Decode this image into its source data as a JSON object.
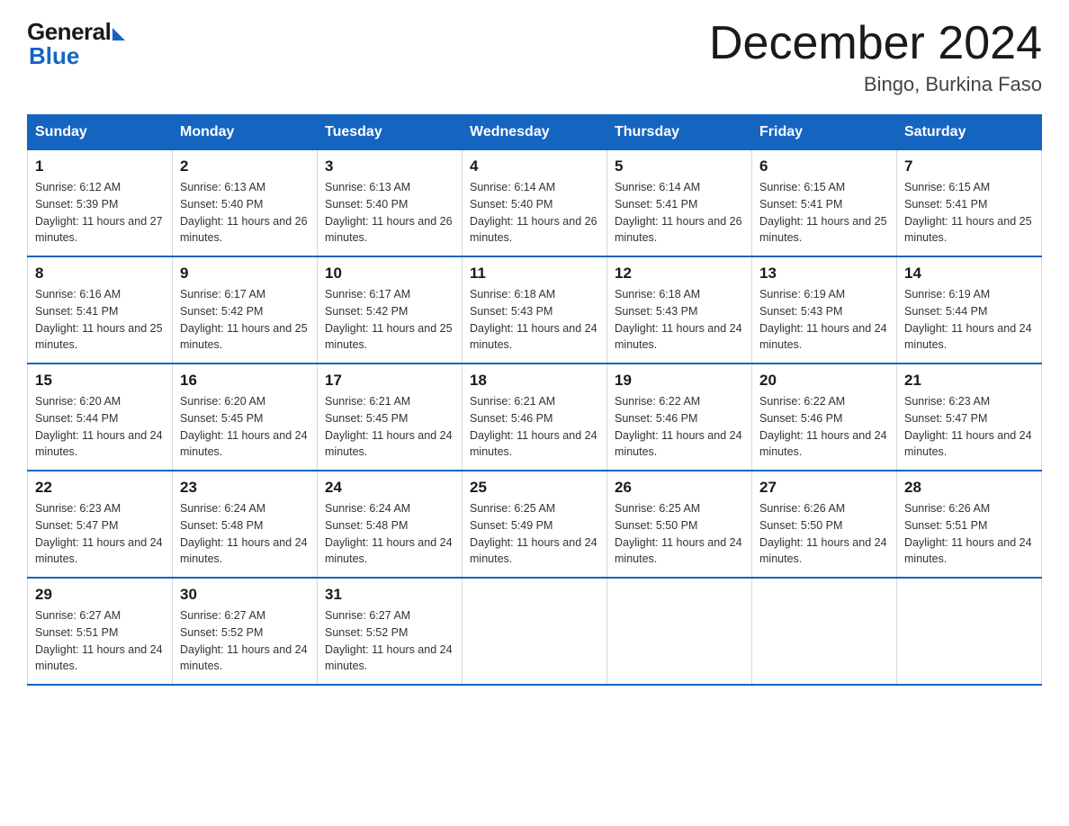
{
  "logo": {
    "general": "General",
    "blue": "Blue"
  },
  "header": {
    "title": "December 2024",
    "subtitle": "Bingo, Burkina Faso"
  },
  "days_of_week": [
    "Sunday",
    "Monday",
    "Tuesday",
    "Wednesday",
    "Thursday",
    "Friday",
    "Saturday"
  ],
  "weeks": [
    [
      {
        "day": "1",
        "sunrise": "6:12 AM",
        "sunset": "5:39 PM",
        "daylight": "11 hours and 27 minutes."
      },
      {
        "day": "2",
        "sunrise": "6:13 AM",
        "sunset": "5:40 PM",
        "daylight": "11 hours and 26 minutes."
      },
      {
        "day": "3",
        "sunrise": "6:13 AM",
        "sunset": "5:40 PM",
        "daylight": "11 hours and 26 minutes."
      },
      {
        "day": "4",
        "sunrise": "6:14 AM",
        "sunset": "5:40 PM",
        "daylight": "11 hours and 26 minutes."
      },
      {
        "day": "5",
        "sunrise": "6:14 AM",
        "sunset": "5:41 PM",
        "daylight": "11 hours and 26 minutes."
      },
      {
        "day": "6",
        "sunrise": "6:15 AM",
        "sunset": "5:41 PM",
        "daylight": "11 hours and 25 minutes."
      },
      {
        "day": "7",
        "sunrise": "6:15 AM",
        "sunset": "5:41 PM",
        "daylight": "11 hours and 25 minutes."
      }
    ],
    [
      {
        "day": "8",
        "sunrise": "6:16 AM",
        "sunset": "5:41 PM",
        "daylight": "11 hours and 25 minutes."
      },
      {
        "day": "9",
        "sunrise": "6:17 AM",
        "sunset": "5:42 PM",
        "daylight": "11 hours and 25 minutes."
      },
      {
        "day": "10",
        "sunrise": "6:17 AM",
        "sunset": "5:42 PM",
        "daylight": "11 hours and 25 minutes."
      },
      {
        "day": "11",
        "sunrise": "6:18 AM",
        "sunset": "5:43 PM",
        "daylight": "11 hours and 24 minutes."
      },
      {
        "day": "12",
        "sunrise": "6:18 AM",
        "sunset": "5:43 PM",
        "daylight": "11 hours and 24 minutes."
      },
      {
        "day": "13",
        "sunrise": "6:19 AM",
        "sunset": "5:43 PM",
        "daylight": "11 hours and 24 minutes."
      },
      {
        "day": "14",
        "sunrise": "6:19 AM",
        "sunset": "5:44 PM",
        "daylight": "11 hours and 24 minutes."
      }
    ],
    [
      {
        "day": "15",
        "sunrise": "6:20 AM",
        "sunset": "5:44 PM",
        "daylight": "11 hours and 24 minutes."
      },
      {
        "day": "16",
        "sunrise": "6:20 AM",
        "sunset": "5:45 PM",
        "daylight": "11 hours and 24 minutes."
      },
      {
        "day": "17",
        "sunrise": "6:21 AM",
        "sunset": "5:45 PM",
        "daylight": "11 hours and 24 minutes."
      },
      {
        "day": "18",
        "sunrise": "6:21 AM",
        "sunset": "5:46 PM",
        "daylight": "11 hours and 24 minutes."
      },
      {
        "day": "19",
        "sunrise": "6:22 AM",
        "sunset": "5:46 PM",
        "daylight": "11 hours and 24 minutes."
      },
      {
        "day": "20",
        "sunrise": "6:22 AM",
        "sunset": "5:46 PM",
        "daylight": "11 hours and 24 minutes."
      },
      {
        "day": "21",
        "sunrise": "6:23 AM",
        "sunset": "5:47 PM",
        "daylight": "11 hours and 24 minutes."
      }
    ],
    [
      {
        "day": "22",
        "sunrise": "6:23 AM",
        "sunset": "5:47 PM",
        "daylight": "11 hours and 24 minutes."
      },
      {
        "day": "23",
        "sunrise": "6:24 AM",
        "sunset": "5:48 PM",
        "daylight": "11 hours and 24 minutes."
      },
      {
        "day": "24",
        "sunrise": "6:24 AM",
        "sunset": "5:48 PM",
        "daylight": "11 hours and 24 minutes."
      },
      {
        "day": "25",
        "sunrise": "6:25 AM",
        "sunset": "5:49 PM",
        "daylight": "11 hours and 24 minutes."
      },
      {
        "day": "26",
        "sunrise": "6:25 AM",
        "sunset": "5:50 PM",
        "daylight": "11 hours and 24 minutes."
      },
      {
        "day": "27",
        "sunrise": "6:26 AM",
        "sunset": "5:50 PM",
        "daylight": "11 hours and 24 minutes."
      },
      {
        "day": "28",
        "sunrise": "6:26 AM",
        "sunset": "5:51 PM",
        "daylight": "11 hours and 24 minutes."
      }
    ],
    [
      {
        "day": "29",
        "sunrise": "6:27 AM",
        "sunset": "5:51 PM",
        "daylight": "11 hours and 24 minutes."
      },
      {
        "day": "30",
        "sunrise": "6:27 AM",
        "sunset": "5:52 PM",
        "daylight": "11 hours and 24 minutes."
      },
      {
        "day": "31",
        "sunrise": "6:27 AM",
        "sunset": "5:52 PM",
        "daylight": "11 hours and 24 minutes."
      },
      null,
      null,
      null,
      null
    ]
  ],
  "labels": {
    "sunrise_prefix": "Sunrise: ",
    "sunset_prefix": "Sunset: ",
    "daylight_prefix": "Daylight: "
  }
}
